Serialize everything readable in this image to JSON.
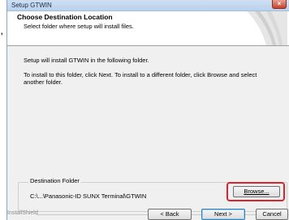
{
  "window": {
    "title": "Setup GTWIN",
    "close_glyph": "×"
  },
  "header": {
    "title": "Choose Destination Location",
    "subtitle": "Select folder where setup will install files."
  },
  "body": {
    "line1": "Setup will install GTWIN in the following folder.",
    "line2": "To install to this folder, click Next. To install to a different folder, click Browse and select another folder."
  },
  "destination": {
    "group_label": "Destination Folder",
    "path": "C:\\...\\Panasonic-ID SUNX Terminal\\GTWIN",
    "browse_label": "Browse..."
  },
  "footer": {
    "brand": "InstallShield",
    "back_label": "< Back",
    "next_label": "Next >",
    "cancel_label": "Cancel"
  },
  "left_margin": {
    "stray_text": ","
  },
  "colors": {
    "highlight": "#d9242b",
    "titlebar": "#b9d1ec"
  }
}
